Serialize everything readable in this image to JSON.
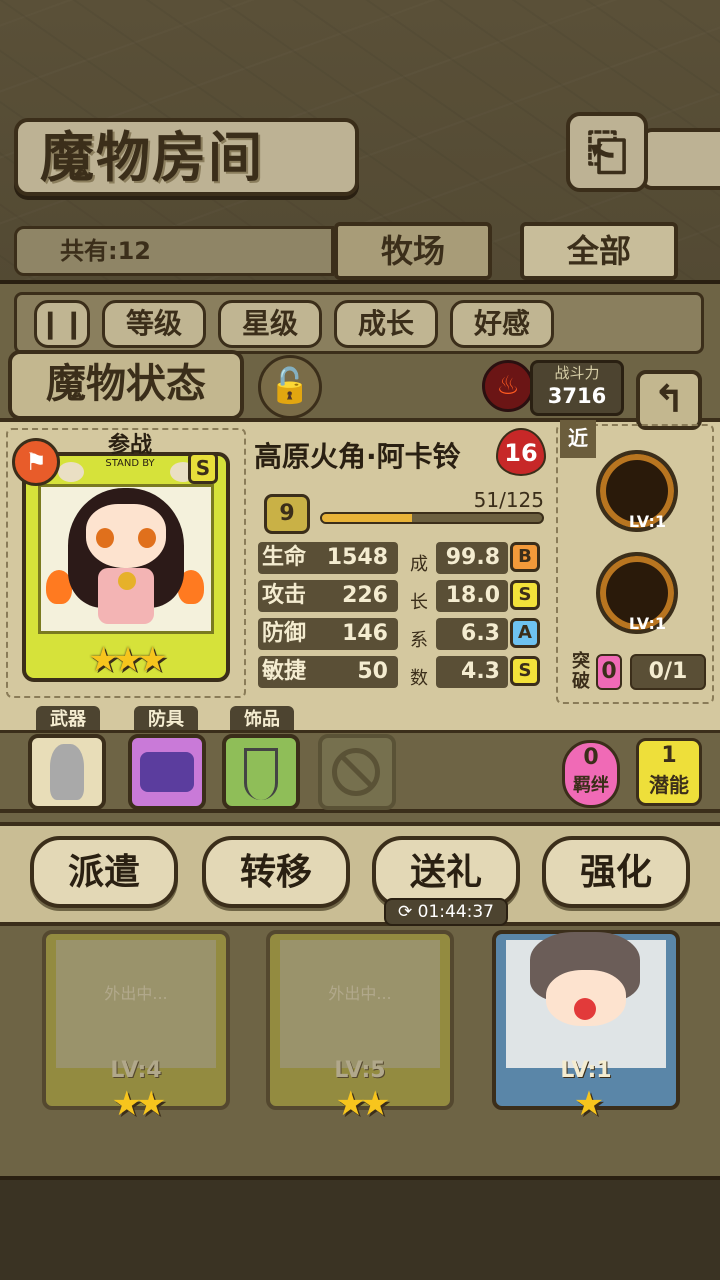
{
  "header": {
    "title": "魔物房间",
    "back_icon": "back-arrow-icon",
    "count_label": "共有:12",
    "tabs": [
      {
        "label": "牧场",
        "active": false
      },
      {
        "label": "全部",
        "active": true
      }
    ]
  },
  "sort": {
    "buttons": [
      "等级",
      "星级",
      "成长",
      "好感"
    ]
  },
  "status": {
    "title": "魔物状态",
    "power_label": "战斗力",
    "power_value": "3716"
  },
  "monster": {
    "name": "高原火角·阿卡铃",
    "level": "16",
    "standby_label": "参战",
    "standby_sub": "STAND BY",
    "rank": "S",
    "star_count": 3,
    "stars": "★★★",
    "tier": "9",
    "exp_text": "51/125",
    "exp_fraction": 0.408,
    "stats": [
      {
        "label": "生命",
        "value": "1548",
        "growth": "99.8",
        "grade": "B"
      },
      {
        "label": "攻击",
        "value": "226",
        "growth": "18.0",
        "grade": "S"
      },
      {
        "label": "防御",
        "value": "146",
        "growth": "6.3",
        "grade": "A"
      },
      {
        "label": "敏捷",
        "value": "50",
        "growth": "4.3",
        "grade": "S"
      }
    ],
    "growth_chars": [
      "成",
      "长",
      "系",
      "数"
    ]
  },
  "skills": {
    "tag": "近",
    "items": [
      {
        "level": "LV:1"
      },
      {
        "level": "LV:1"
      }
    ],
    "break_label": "突破",
    "break_value": "0",
    "break_progress": "0/1"
  },
  "equipment": {
    "slots": [
      {
        "label": "武器"
      },
      {
        "label": "防具"
      },
      {
        "label": "饰品"
      }
    ],
    "bond_value": "0",
    "bond_label": "羁绊",
    "potential_value": "1",
    "potential_label": "潜能"
  },
  "actions": {
    "buttons": [
      "派遣",
      "转移",
      "送礼",
      "强化"
    ],
    "timer": "01:44:37"
  },
  "roster": [
    {
      "status": "外出中...",
      "level": "LV:4",
      "stars": "★★"
    },
    {
      "status": "外出中...",
      "level": "LV:5",
      "stars": "★★"
    },
    {
      "status": "",
      "level": "LV:1",
      "stars": "★"
    }
  ]
}
